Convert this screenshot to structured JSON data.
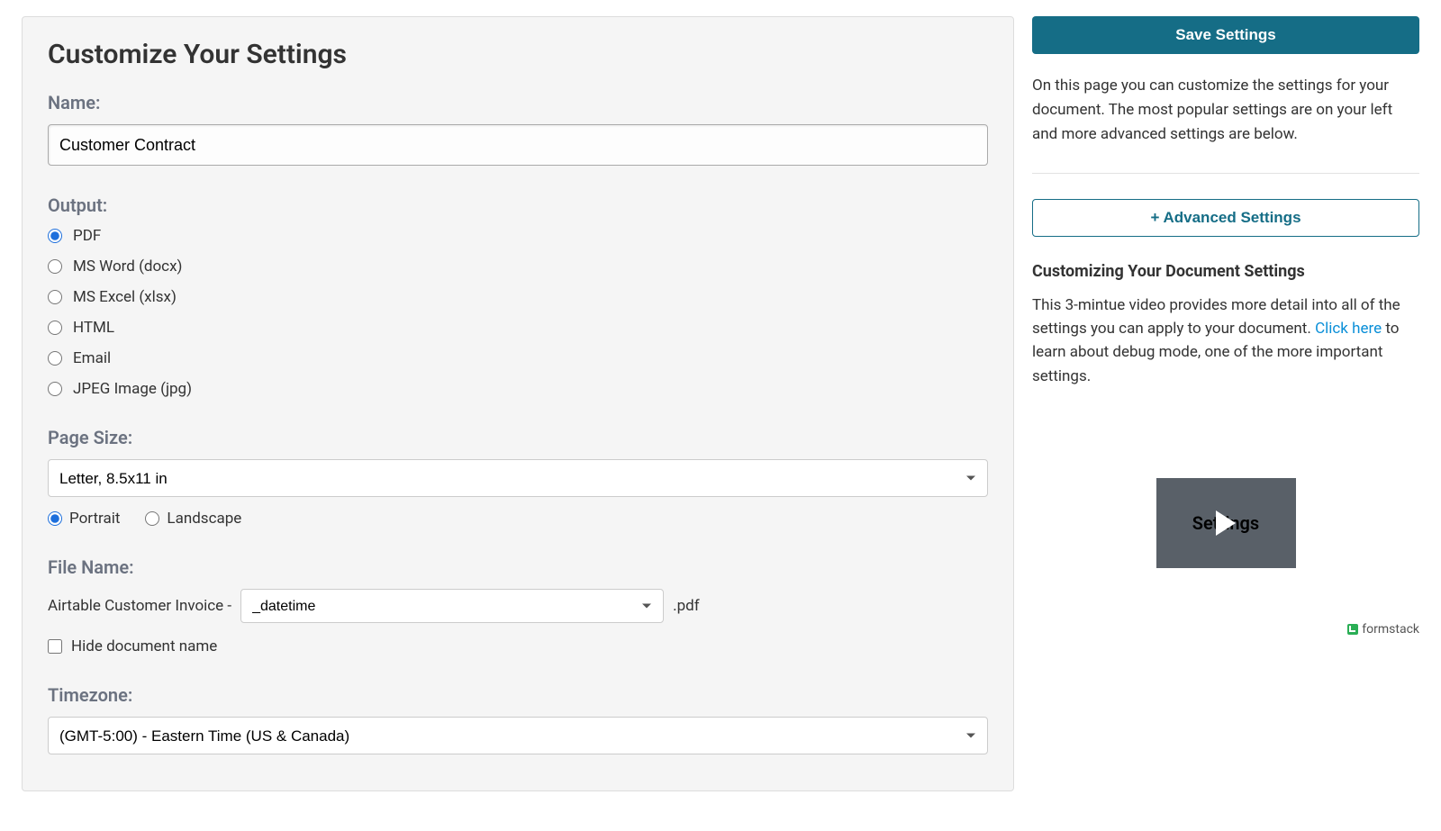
{
  "main": {
    "title": "Customize Your Settings",
    "name": {
      "label": "Name:",
      "value": "Customer Contract"
    },
    "output": {
      "label": "Output:",
      "options": [
        {
          "label": "PDF",
          "selected": true
        },
        {
          "label": "MS Word (docx)",
          "selected": false
        },
        {
          "label": "MS Excel (xlsx)",
          "selected": false
        },
        {
          "label": "HTML",
          "selected": false
        },
        {
          "label": "Email",
          "selected": false
        },
        {
          "label": "JPEG Image (jpg)",
          "selected": false
        }
      ]
    },
    "pageSize": {
      "label": "Page Size:",
      "selected": "Letter, 8.5x11 in",
      "orientation": {
        "portrait": {
          "label": "Portrait",
          "selected": true
        },
        "landscape": {
          "label": "Landscape",
          "selected": false
        }
      }
    },
    "fileName": {
      "label": "File Name:",
      "prefix": "Airtable Customer Invoice -",
      "suffix": "_datetime",
      "extension": ".pdf",
      "hideCheckboxLabel": "Hide document name",
      "hideChecked": false
    },
    "timezone": {
      "label": "Timezone:",
      "selected": "(GMT-5:00) - Eastern Time (US & Canada)"
    }
  },
  "sidebar": {
    "saveLabel": "Save Settings",
    "descText": "On this page you can customize the settings for your document. The most popular settings are on your left and more advanced settings are below.",
    "advancedLabel": "+ Advanced Settings",
    "helpHeading": "Customizing Your Document Settings",
    "helpText1": "This 3-mintue video provides more detail into all of the settings you can apply to your document. ",
    "helpLink": "Click here",
    "helpText2": " to learn about debug mode, one of the more important settings.",
    "videoText": "Settings",
    "brand": "formstack "
  }
}
